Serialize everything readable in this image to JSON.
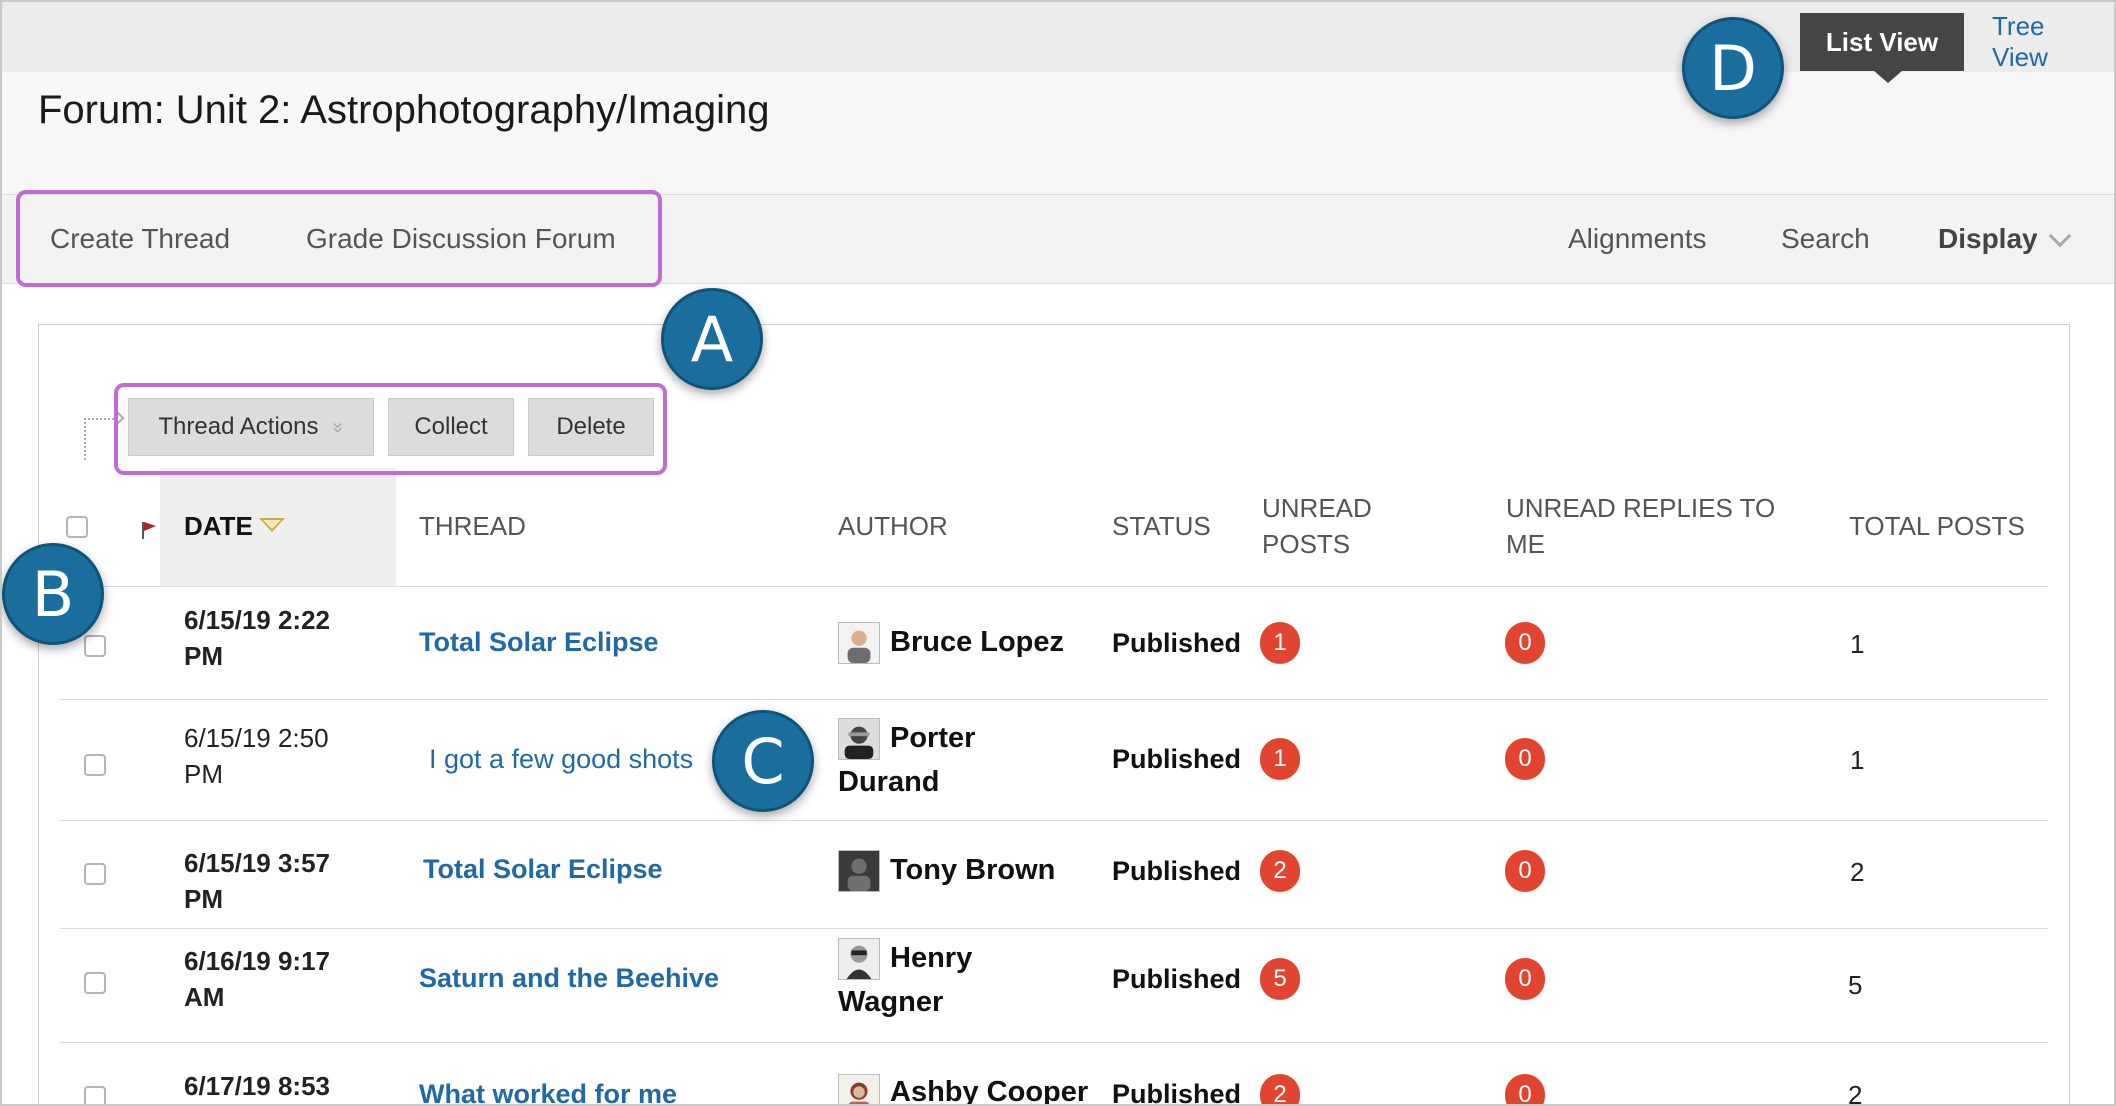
{
  "forum": {
    "title": "Forum: Unit 2: Astrophotography/Imaging"
  },
  "view_toggle": {
    "list_view": "List View",
    "tree_view": "Tree View"
  },
  "action_bar": {
    "create_thread": "Create Thread",
    "grade_forum": "Grade Discussion Forum",
    "alignments": "Alignments",
    "search": "Search",
    "display": "Display"
  },
  "toolbar": {
    "thread_actions": "Thread Actions",
    "collect": "Collect",
    "delete": "Delete"
  },
  "columns": {
    "date": "DATE",
    "thread": "THREAD",
    "author": "AUTHOR",
    "status": "STATUS",
    "unread_posts_1": "UNREAD",
    "unread_posts_2": "POSTS",
    "unread_replies_1": "UNREAD REPLIES TO",
    "unread_replies_2": "ME",
    "total_posts": "TOTAL POSTS"
  },
  "rows": [
    {
      "date_1": "6/15/19 2:22",
      "date_2": "PM",
      "thread": "Total Solar Eclipse",
      "author_1": "Bruce Lopez",
      "author_2": "",
      "status": "Published",
      "unread": "1",
      "replies": "0",
      "total": "1",
      "unread_style": true
    },
    {
      "date_1": "6/15/19 2:50",
      "date_2": "PM",
      "thread": "I got a few good shots",
      "author_1": "Porter",
      "author_2": "Durand",
      "status": "Published",
      "unread": "1",
      "replies": "0",
      "total": "1",
      "unread_style": false
    },
    {
      "date_1": "6/15/19 3:57",
      "date_2": "PM",
      "thread": "Total Solar Eclipse",
      "author_1": "Tony Brown",
      "author_2": "",
      "status": "Published",
      "unread": "2",
      "replies": "0",
      "total": "2",
      "unread_style": true
    },
    {
      "date_1": "6/16/19 9:17",
      "date_2": "AM",
      "thread": "Saturn and the Beehive",
      "author_1": "Henry",
      "author_2": "Wagner",
      "status": "Published",
      "unread": "5",
      "replies": "0",
      "total": "5",
      "unread_style": true
    },
    {
      "date_1": "6/17/19 8:53",
      "date_2": "",
      "thread": "What worked for me",
      "author_1": "Ashby Cooper",
      "author_2": "",
      "status": "Published",
      "unread": "2",
      "replies": "0",
      "total": "2",
      "unread_style": true
    }
  ],
  "markers": {
    "a": "A",
    "b": "B",
    "c": "C",
    "d": "D"
  },
  "colors": {
    "link": "#1f6aa5",
    "badge": "#e2452f",
    "highlight": "#c26bd6",
    "marker": "#1a6e9e"
  }
}
